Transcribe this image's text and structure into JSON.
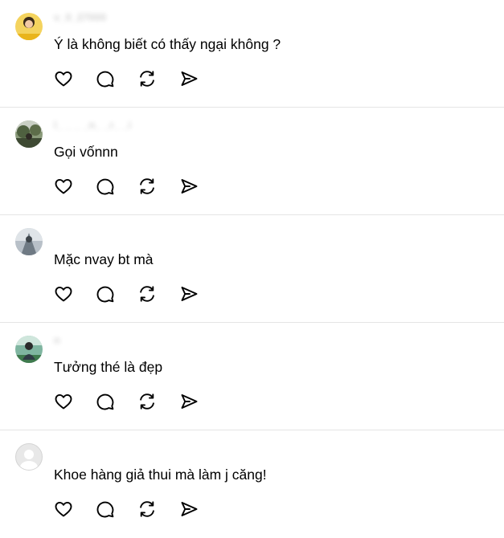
{
  "posts": [
    {
      "username": "v_0_27000",
      "text": "Ý là không biết có thấy ngại không ?",
      "avatar": "photo-avatar-yellow"
    },
    {
      "username": "l_ _ _ _n_ _r_ _i",
      "text": "Gọi vốnnn",
      "avatar": "photo-avatar-nature"
    },
    {
      "username": "",
      "text": "Mặc nvay bt mà",
      "avatar": "photo-avatar-gray"
    },
    {
      "username": "n",
      "text": "Tưởng thé là đẹp",
      "avatar": "photo-avatar-outdoor"
    },
    {
      "username": "",
      "text": "Khoe hàng giả thui mà làm j căng!",
      "avatar": "default-avatar"
    }
  ],
  "action_icons": [
    "heart-icon",
    "comment-icon",
    "repost-icon",
    "share-icon"
  ],
  "colors": {
    "background": "#ffffff",
    "divider": "#e5e5e5",
    "text": "#000000",
    "icon": "#000000"
  }
}
